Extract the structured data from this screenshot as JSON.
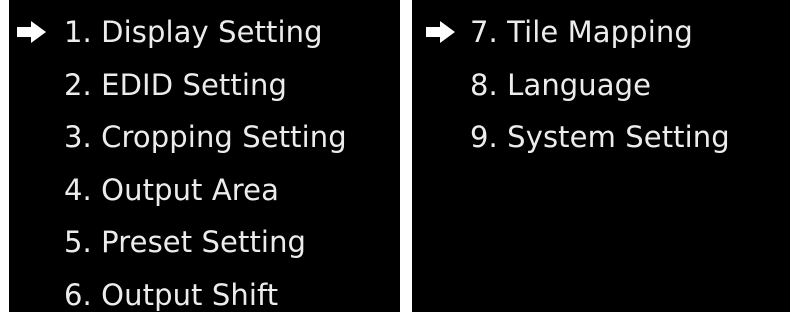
{
  "left_panel": {
    "items": [
      {
        "label": "1. Display Setting",
        "selected": true
      },
      {
        "label": "2. EDID Setting",
        "selected": false
      },
      {
        "label": "3. Cropping Setting",
        "selected": false
      },
      {
        "label": "4. Output Area",
        "selected": false
      },
      {
        "label": "5. Preset Setting",
        "selected": false
      },
      {
        "label": "6. Output Shift",
        "selected": false
      }
    ]
  },
  "right_panel": {
    "items": [
      {
        "label": "7. Tile Mapping",
        "selected": true
      },
      {
        "label": "8. Language",
        "selected": false
      },
      {
        "label": "9. System Setting",
        "selected": false
      }
    ]
  },
  "pointer_icon": "arrow-right-icon",
  "colors": {
    "background": "#000000",
    "text": "#ececec",
    "pointer": "#ffffff",
    "page": "#ffffff"
  }
}
